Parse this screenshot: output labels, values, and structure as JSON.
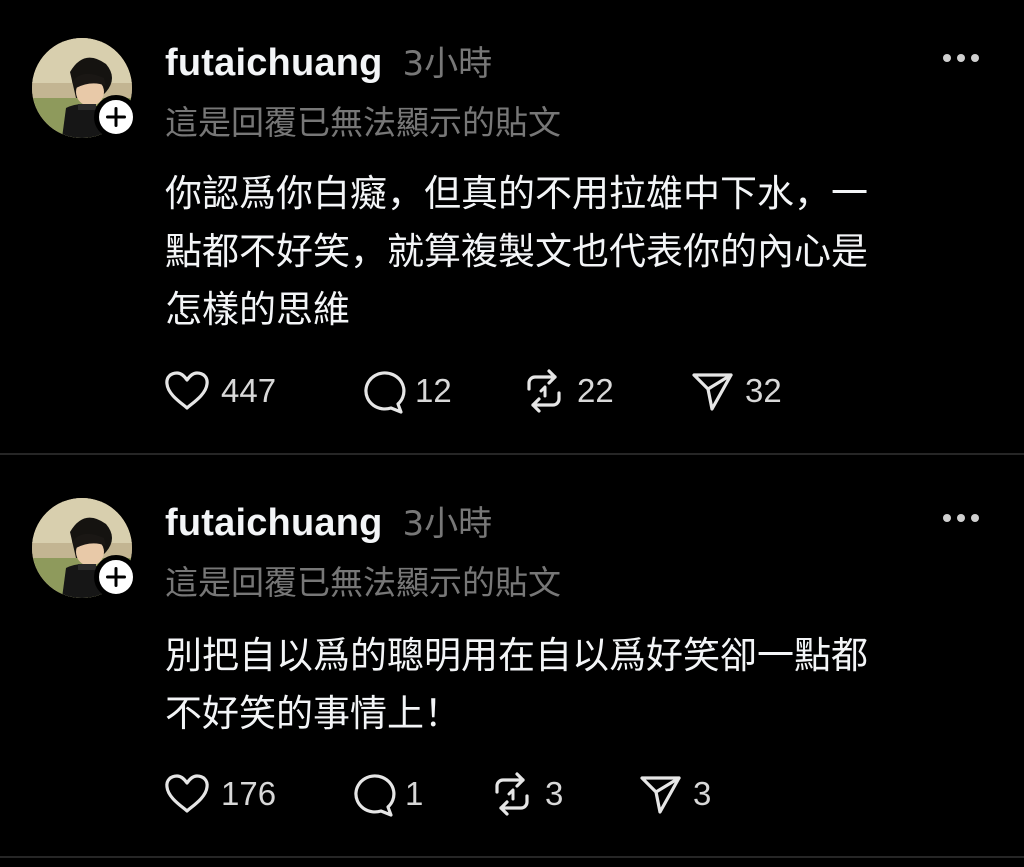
{
  "theme": {
    "background": "#000000",
    "text_primary": "#f3f5f7",
    "text_secondary": "#777777",
    "divider": "#262626"
  },
  "posts": [
    {
      "username": "futaichuang",
      "timestamp": "3小時",
      "reply_context": "這是回覆已無法顯示的貼文",
      "body_lines": [
        "你認爲你白癡，但真的不用拉雄中下水，一",
        "點都不好笑，就算複製文也代表你的內心是",
        "怎樣的思維"
      ],
      "likes": "447",
      "replies": "12",
      "reposts": "22",
      "shares": "32",
      "icons": {
        "avatar": "avatar-photo",
        "follow": "plus-icon",
        "more": "more-dots-icon",
        "like": "heart-icon",
        "reply": "comment-bubble-icon",
        "repost": "repost-arrows-icon",
        "share": "send-arrow-icon"
      }
    },
    {
      "username": "futaichuang",
      "timestamp": "3小時",
      "reply_context": "這是回覆已無法顯示的貼文",
      "body_lines": [
        "別把自以爲的聰明用在自以爲好笑卻一點都",
        "不好笑的事情上！"
      ],
      "likes": "176",
      "replies": "1",
      "reposts": "3",
      "shares": "3",
      "icons": {
        "avatar": "avatar-photo",
        "follow": "plus-icon",
        "more": "more-dots-icon",
        "like": "heart-icon",
        "reply": "comment-bubble-icon",
        "repost": "repost-arrows-icon",
        "share": "send-arrow-icon"
      }
    }
  ]
}
